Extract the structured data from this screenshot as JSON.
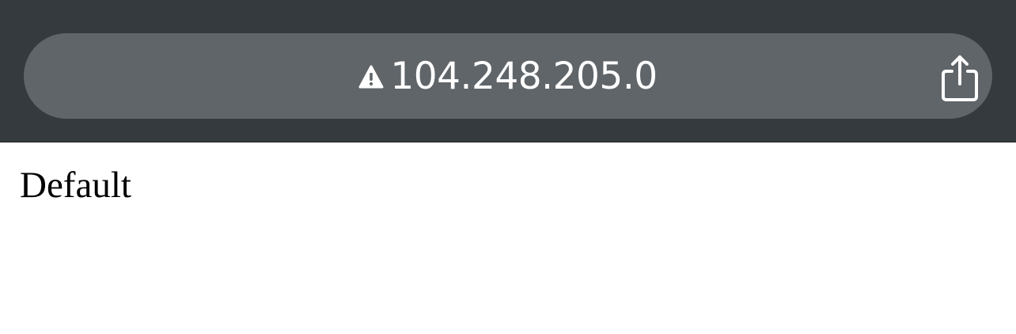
{
  "browser": {
    "url": "104.248.205.0",
    "security_icon": "warning-icon",
    "share_icon": "share-icon"
  },
  "page": {
    "text": "Default"
  },
  "colors": {
    "chrome_background": "#353a3e",
    "address_bar_background": "#606569",
    "url_text": "#ffffff",
    "page_background": "#ffffff",
    "page_text": "#000000"
  }
}
